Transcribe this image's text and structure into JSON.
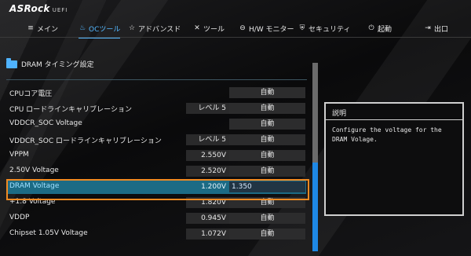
{
  "brand": {
    "name": "ASRock",
    "sub": "UEFI"
  },
  "nav": [
    {
      "id": "main",
      "icon": "≡",
      "label": "メイン",
      "active": false
    },
    {
      "id": "oc",
      "icon": "♨",
      "label": "OCツール",
      "active": true
    },
    {
      "id": "adv",
      "icon": "☆",
      "label": "アドバンスド",
      "active": false
    },
    {
      "id": "tool",
      "icon": "✕",
      "label": "ツール",
      "active": false
    },
    {
      "id": "hw",
      "icon": "⊖",
      "label": "H/W モニター",
      "active": false
    },
    {
      "id": "sec",
      "icon": "⛨",
      "label": "セキュリティ",
      "active": false
    },
    {
      "id": "boot",
      "icon": "⏻",
      "label": "起動",
      "active": false
    },
    {
      "id": "exit",
      "icon": "⇥",
      "label": "出口",
      "active": false
    }
  ],
  "section": {
    "title": "DRAM タイミング設定"
  },
  "rows": [
    {
      "label": "CPUコア電圧",
      "current": "",
      "value": "自動"
    },
    {
      "label": "CPU ロードラインキャリブレーション",
      "current": "レベル 5",
      "value": "自動"
    },
    {
      "label": "VDDCR_SOC Voltage",
      "current": "",
      "value": "自動"
    },
    {
      "label": "VDDCR_SOC ロードラインキャリブレーション",
      "current": "レベル 5",
      "value": "自動"
    },
    {
      "label": "VPPM",
      "current": "2.550V",
      "value": "自動"
    },
    {
      "label": "2.50V Voltage",
      "current": "2.520V",
      "value": "自動"
    },
    {
      "label": "DRAM Voltage",
      "current": "1.200V",
      "value": "1.350",
      "selected": true
    },
    {
      "label": "+1.8 Voltage",
      "current": "1.820V",
      "value": "自動"
    },
    {
      "label": "VDDP",
      "current": "0.945V",
      "value": "自動"
    },
    {
      "label": "Chipset 1.05V Voltage",
      "current": "1.072V",
      "value": "自動"
    }
  ],
  "help": {
    "title": "説明",
    "text": "Configure the voltage for the DRAM Volage."
  }
}
